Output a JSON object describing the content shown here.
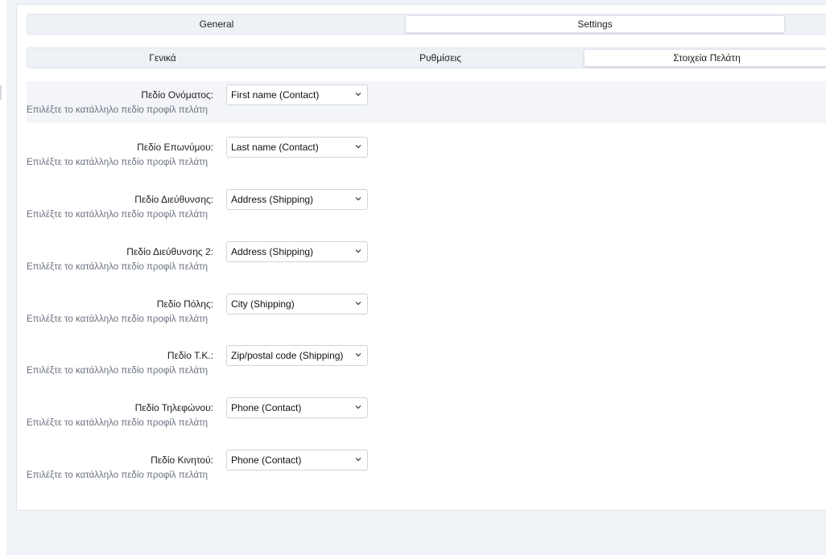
{
  "tabs_top": [
    {
      "label": "General",
      "active": false
    },
    {
      "label": "Settings",
      "active": true
    }
  ],
  "tabs_sub": [
    {
      "label": "Γενικά",
      "active": false
    },
    {
      "label": "Ρυθμίσεις",
      "active": false
    },
    {
      "label": "Στοιχεία Πελάτη",
      "active": true
    }
  ],
  "fields": [
    {
      "label": "Πεδίο Ονόματος:",
      "value": "First name (Contact)",
      "help": "Επιλέξτε το κατάλληλο πεδίο προφίλ πελάτη"
    },
    {
      "label": "Πεδίο Επωνύμου:",
      "value": "Last name (Contact)",
      "help": "Επιλέξτε το κατάλληλο πεδίο προφίλ πελάτη"
    },
    {
      "label": "Πεδίο Διεύθυνσης:",
      "value": "Address (Shipping)",
      "help": "Επιλέξτε το κατάλληλο πεδίο προφίλ πελάτη"
    },
    {
      "label": "Πεδίο Διεύθυνσης 2:",
      "value": "Address (Shipping)",
      "help": "Επιλέξτε το κατάλληλο πεδίο προφίλ πελάτη"
    },
    {
      "label": "Πεδίο Πόλης:",
      "value": "City (Shipping)",
      "help": "Επιλέξτε το κατάλληλο πεδίο προφίλ πελάτη"
    },
    {
      "label": "Πεδίο Τ.Κ.:",
      "value": "Zip/postal code (Shipping)",
      "help": "Επιλέξτε το κατάλληλο πεδίο προφίλ πελάτη"
    },
    {
      "label": "Πεδίο Τηλεφώνου:",
      "value": "Phone (Contact)",
      "help": "Επιλέξτε το κατάλληλο πεδίο προφίλ πελάτη"
    },
    {
      "label": "Πεδίο Κινητού:",
      "value": "Phone (Contact)",
      "help": "Επιλέξτε το κατάλληλο πεδίο προφίλ πελάτη"
    }
  ],
  "icons": {
    "select_chevron": "chevron-down-icon"
  }
}
